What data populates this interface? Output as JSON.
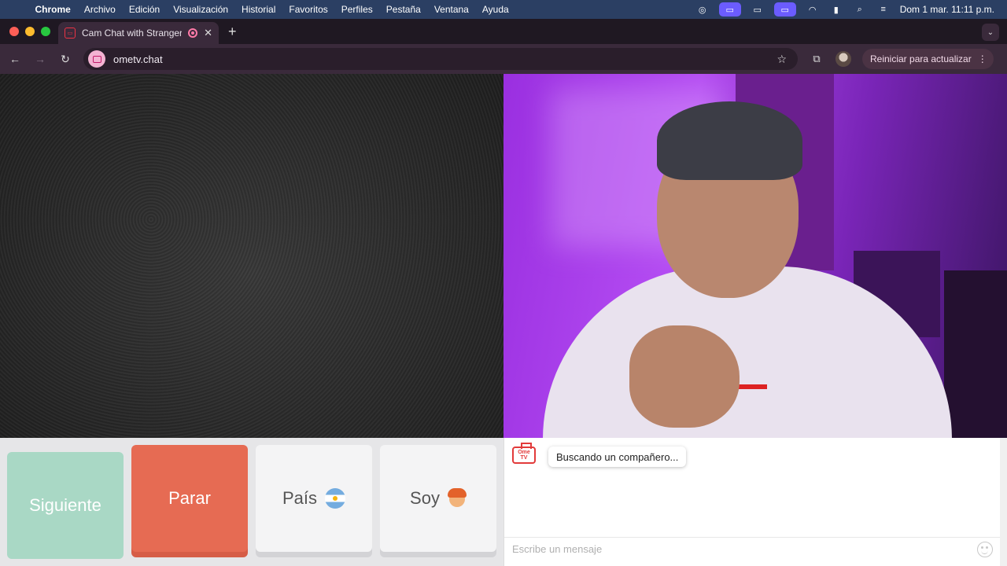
{
  "menubar": {
    "app_name": "Chrome",
    "items": [
      "Archivo",
      "Edición",
      "Visualización",
      "Historial",
      "Favoritos",
      "Perfiles",
      "Pestaña",
      "Ventana",
      "Ayuda"
    ],
    "clock": "Dom 1 mar.  11:11 p.m."
  },
  "tab": {
    "title": "Cam Chat with Strangers",
    "close": "✕"
  },
  "toolbar": {
    "url": "ometv.chat",
    "update_label": "Reiniciar para actualizar"
  },
  "controls": {
    "next_label": "Siguiente",
    "stop_label": "Parar",
    "country_label": "País",
    "gender_label": "Soy"
  },
  "chat": {
    "logo_text": "Ome TV",
    "status_message": "Buscando un compañero...",
    "input_placeholder": "Escribe un mensaje"
  },
  "colors": {
    "next_button": "#a9d8c5",
    "stop_button": "#e66b53",
    "menubar": "#2b3f63",
    "toolbar": "#3a2a3b"
  }
}
